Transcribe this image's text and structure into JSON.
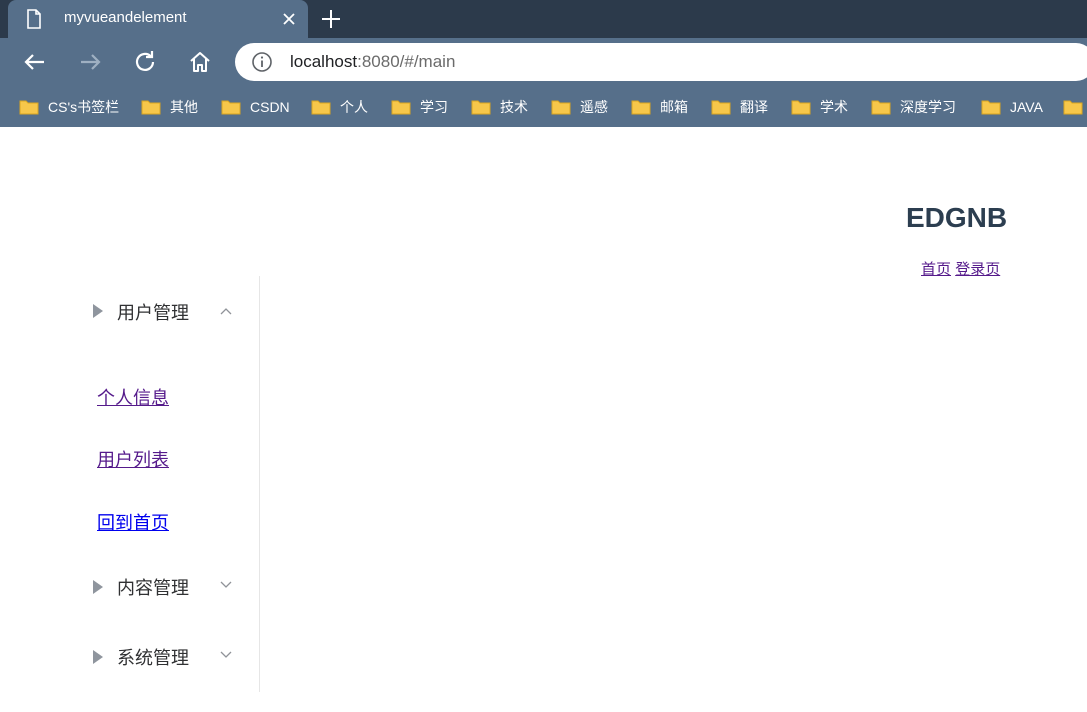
{
  "browser": {
    "tab": {
      "title": "myvueandelement"
    },
    "address": {
      "host": "localhost",
      "rest": ":8080/#/main"
    },
    "bookmarks": [
      "CS's书签栏",
      "其他",
      "CSDN",
      "个人",
      "学习",
      "技术",
      "遥感",
      "邮箱",
      "翻译",
      "学术",
      "深度学习",
      "JAVA"
    ]
  },
  "page": {
    "title": "EDGNB",
    "links": {
      "home": "首页",
      "login": "登录页"
    }
  },
  "sidebar": {
    "groups": [
      {
        "label": "用户管理",
        "expanded": true,
        "items": [
          "个人信息",
          "用户列表",
          "回到首页"
        ]
      },
      {
        "label": "内容管理",
        "expanded": false
      },
      {
        "label": "系统管理",
        "expanded": false
      }
    ]
  },
  "colors": {
    "chrome": "#566f8a",
    "tabstrip": "#2c3a4b",
    "title": "#2c3e50",
    "visited_link": "#551a8b",
    "link": "#0000ee"
  }
}
